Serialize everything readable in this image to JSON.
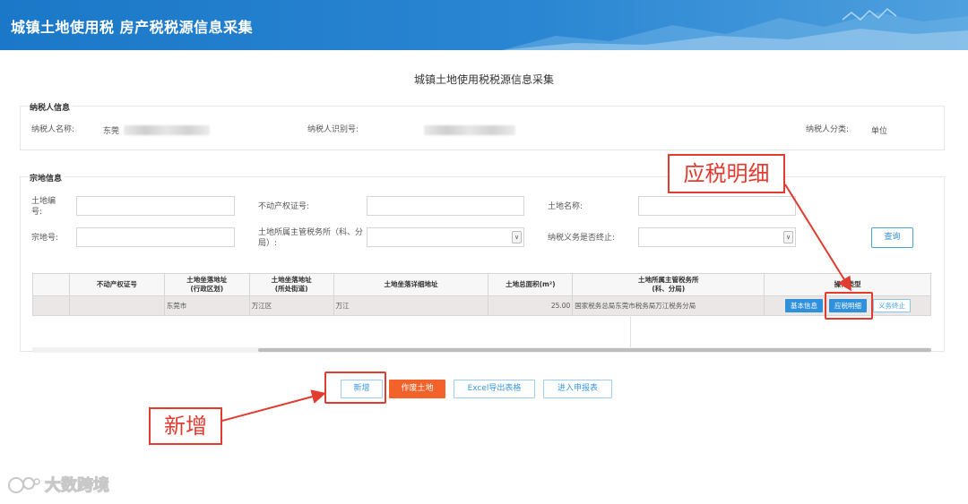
{
  "header": {
    "title": "城镇土地使用税 房产税税源信息采集"
  },
  "page": {
    "title": "城镇土地使用税税源信息采集"
  },
  "taxpayer": {
    "section_title": "纳税人信息",
    "name_label": "纳税人名称:",
    "name_value": "东莞",
    "id_label": "纳税人识别号:",
    "category_label": "纳税人分类:",
    "category_value": "单位"
  },
  "parcel": {
    "section_title": "宗地信息",
    "land_no_label": "土地编号:",
    "property_cert_label": "不动产权证号:",
    "land_name_label": "土地名称:",
    "parcel_no_label": "宗地号:",
    "tax_office_label": "土地所属主管税务所（科、分局）:",
    "obligation_end_label": "纳税义务是否终止:",
    "query_button": "查询"
  },
  "table": {
    "headers": [
      "不动产权证号",
      "土地坐落地址\n(行政区划)",
      "土地坐落地址\n(所处街道)",
      "土地坐落详细地址",
      "土地总面积(m²)",
      "土地所属主管税务所\n(科、分局)",
      "操作类型"
    ],
    "rows": [
      {
        "cert": "",
        "district": "东莞市",
        "street": "万江区",
        "detail": "万江",
        "area": "25.00",
        "office": "国家税务总局东莞市税务局万江税务分局"
      }
    ],
    "op_basic": "基本信息",
    "op_detail": "应税明细",
    "op_end": "义务终止"
  },
  "buttons": {
    "add": "新增",
    "void": "作废土地",
    "export": "Excel导出表格",
    "enter": "进入申报表"
  },
  "annotations": {
    "detail_callout": "应税明细",
    "add_callout": "新增"
  },
  "watermark": "大数跨境",
  "colors": {
    "header": "#1b78c8",
    "accent_blue": "#2f90dc",
    "orange": "#f2622a",
    "annotation_red": "#e23b30"
  }
}
